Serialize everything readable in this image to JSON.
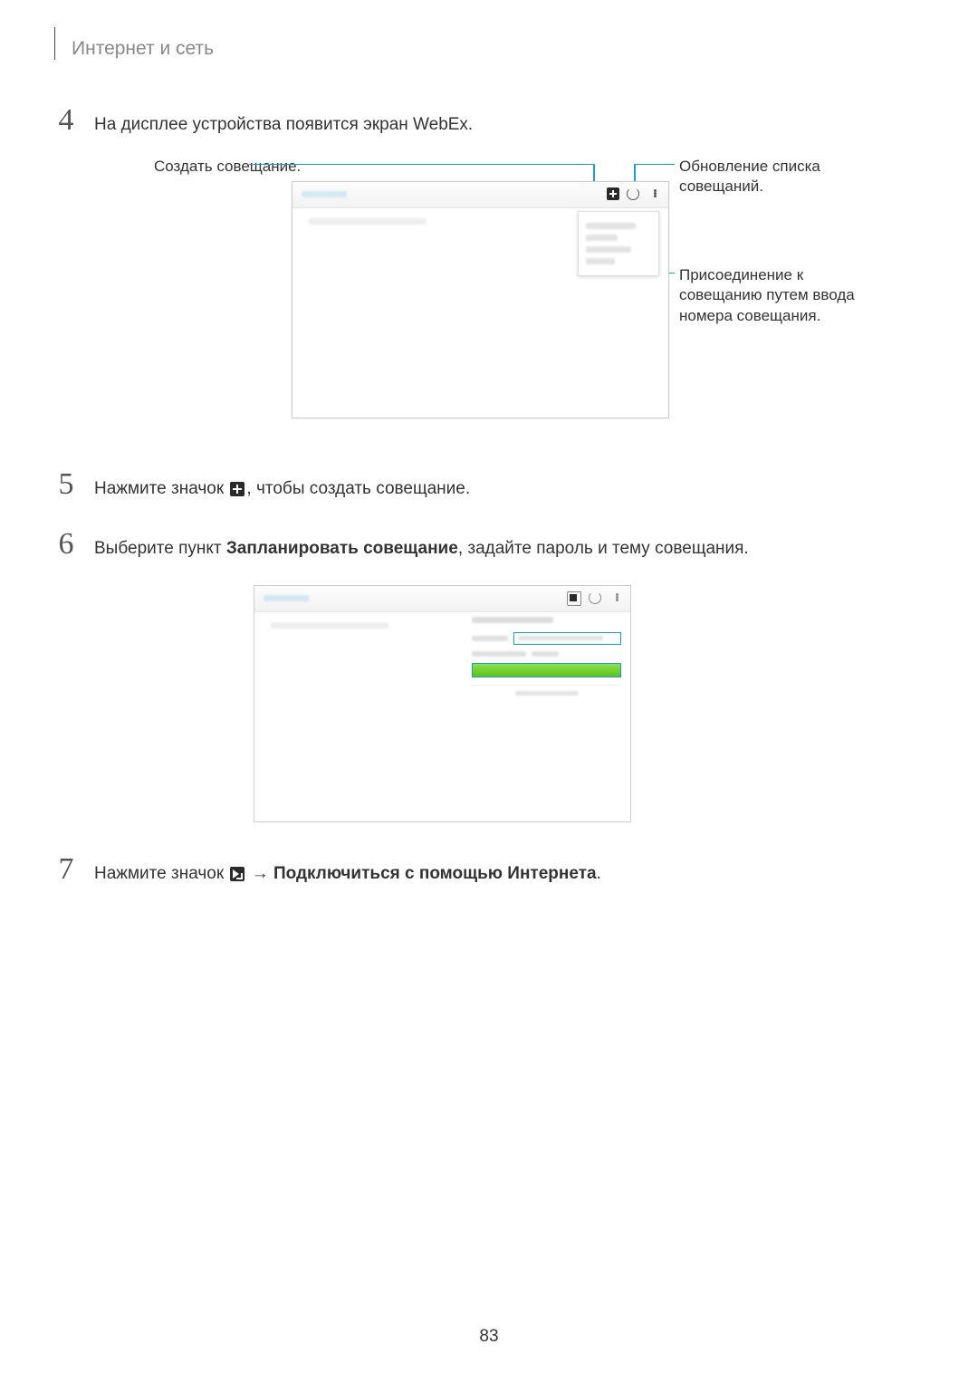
{
  "header": {
    "section": "Интернет и сеть"
  },
  "steps": {
    "s4": {
      "num": "4",
      "text": "На дисплее устройства появится экран WebEx."
    },
    "s5": {
      "num": "5",
      "pre": "Нажмите значок ",
      "post": ", чтобы создать совещание."
    },
    "s6": {
      "num": "6",
      "pre": "Выберите пункт ",
      "bold": "Запланировать совещание",
      "post": ", задайте пароль и тему совещания."
    },
    "s7": {
      "num": "7",
      "pre": "Нажмите значок ",
      "arrow": " → ",
      "bold": "Подключиться с помощью Интернета",
      "post": "."
    }
  },
  "callouts": {
    "create": "Создать совещание.",
    "refresh": "Обновление списка совещаний.",
    "join": "Присоединение к совещанию путем ввода номера совещания."
  },
  "page_number": "83"
}
